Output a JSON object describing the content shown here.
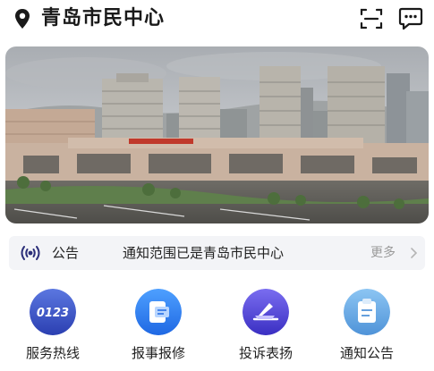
{
  "header": {
    "title": "青岛市民中心",
    "location_icon": "location-pin-icon",
    "scan_icon": "scan-icon",
    "message_icon": "message-icon"
  },
  "banner": {
    "image": "city-building-photo"
  },
  "notice": {
    "icon": "broadcast-icon",
    "label": "公告",
    "text": "通知范围已是青岛市民中心",
    "more": "更多",
    "more_icon": "chevron-right-icon"
  },
  "services": [
    {
      "label": "服务热线",
      "icon_text": "0123",
      "icon": "hotline-icon",
      "color": "#3b56c9"
    },
    {
      "label": "报事报修",
      "icon": "repair-report-icon",
      "color": "#2f7df0"
    },
    {
      "label": "投诉表扬",
      "icon": "complaint-praise-icon",
      "color": "#4b3fd1"
    },
    {
      "label": "通知公告",
      "icon": "notice-board-icon",
      "color": "#62a7e6"
    }
  ]
}
